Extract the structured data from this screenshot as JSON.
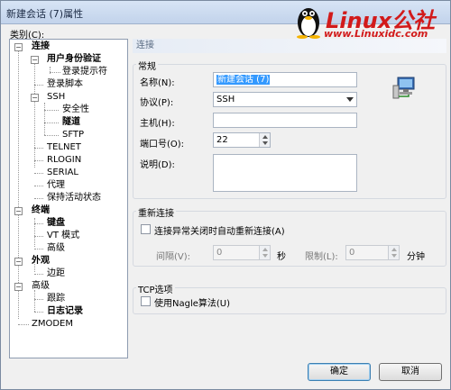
{
  "window": {
    "title": "新建会话 (7)属性"
  },
  "logo": {
    "text": "Linux公社",
    "site": "www.Linuxidc.com",
    "penguin_icon": "penguin-icon"
  },
  "category_label": "类别(C):",
  "tree": [
    {
      "label": "连接",
      "bold": true
    },
    {
      "label": "用户身份验证",
      "bold": true
    },
    {
      "label": "登录提示符",
      "bold": false
    },
    {
      "label": "登录脚本",
      "bold": false
    },
    {
      "label": "SSH",
      "bold": false
    },
    {
      "label": "安全性",
      "bold": false
    },
    {
      "label": "隧道",
      "bold": true
    },
    {
      "label": "SFTP",
      "bold": false
    },
    {
      "label": "TELNET",
      "bold": false
    },
    {
      "label": "RLOGIN",
      "bold": false
    },
    {
      "label": "SERIAL",
      "bold": false
    },
    {
      "label": "代理",
      "bold": false
    },
    {
      "label": "保持活动状态",
      "bold": false
    },
    {
      "label": "终端",
      "bold": true
    },
    {
      "label": "键盘",
      "bold": true
    },
    {
      "label": "VT 模式",
      "bold": false
    },
    {
      "label": "高级",
      "bold": false
    },
    {
      "label": "外观",
      "bold": true
    },
    {
      "label": "边距",
      "bold": false
    },
    {
      "label": "高级",
      "bold": false
    },
    {
      "label": "跟踪",
      "bold": false
    },
    {
      "label": "日志记录",
      "bold": true
    },
    {
      "label": "ZMODEM",
      "bold": false
    }
  ],
  "section_header": "连接",
  "general": {
    "title": "常规",
    "name_label": "名称(N):",
    "name_value": "新建会话 (7)",
    "protocol_label": "协议(P):",
    "protocol_value": "SSH",
    "host_label": "主机(H):",
    "host_value": "",
    "port_label": "端口号(O):",
    "port_value": "22",
    "desc_label": "说明(D):",
    "desc_value": ""
  },
  "reconnect": {
    "title": "重新连接",
    "auto_label": "连接异常关闭时自动重新连接(A)",
    "interval_label": "间隔(V):",
    "interval_value": "0",
    "interval_unit": "秒",
    "limit_label": "限制(L):",
    "limit_value": "0",
    "limit_unit": "分钟"
  },
  "tcp": {
    "title": "TCP选项",
    "nagle_label": "使用Nagle算法(U)"
  },
  "buttons": {
    "ok": "确定",
    "cancel": "取消"
  }
}
